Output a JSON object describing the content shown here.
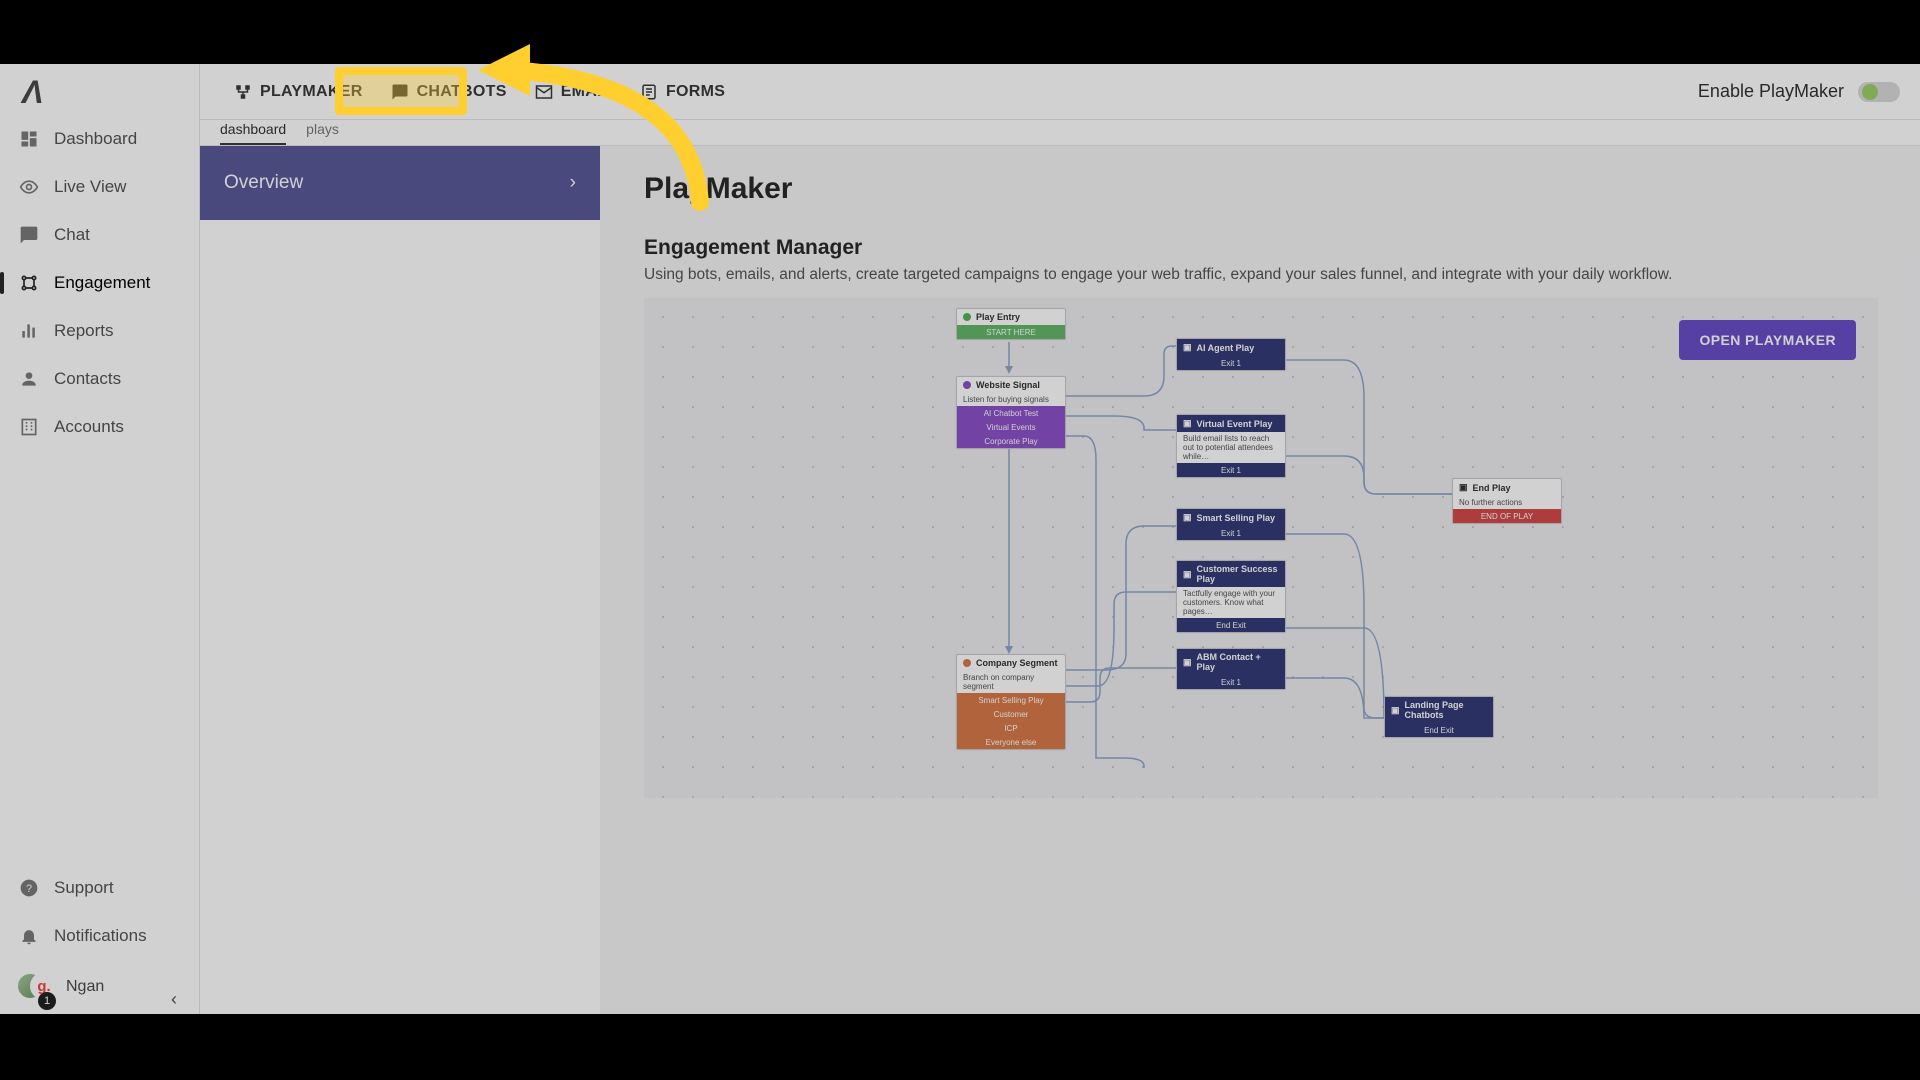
{
  "sidebar": {
    "items": [
      {
        "label": "Dashboard",
        "icon": "dashboard"
      },
      {
        "label": "Live View",
        "icon": "eye"
      },
      {
        "label": "Chat",
        "icon": "chat"
      },
      {
        "label": "Engagement",
        "icon": "engagement"
      },
      {
        "label": "Reports",
        "icon": "bar"
      },
      {
        "label": "Contacts",
        "icon": "person"
      },
      {
        "label": "Accounts",
        "icon": "building"
      }
    ],
    "bottom": [
      {
        "label": "Support",
        "icon": "help"
      },
      {
        "label": "Notifications",
        "icon": "bell"
      }
    ],
    "user": {
      "name": "Ngan",
      "badge": "1",
      "g": "g."
    }
  },
  "topTabs": [
    {
      "label": "PLAYMAKER",
      "icon": "flow"
    },
    {
      "label": "CHATBOTS",
      "icon": "chat"
    },
    {
      "label": "EMAIL",
      "icon": "mail"
    },
    {
      "label": "FORMS",
      "icon": "form"
    }
  ],
  "enable": {
    "label": "Enable PlayMaker"
  },
  "subTabs": [
    "dashboard",
    "plays"
  ],
  "overview": {
    "label": "Overview"
  },
  "page": {
    "title": "PlayMaker",
    "subtitle": "Engagement Manager",
    "desc": "Using bots, emails, and alerts, create targeted campaigns to engage your web traffic, expand your sales funnel, and integrate with your daily workflow.",
    "openBtn": "OPEN PLAYMAKER"
  },
  "flow": {
    "playEntry": {
      "title": "Play Entry",
      "bar": "START HERE"
    },
    "websiteSignal": {
      "title": "Website Signal",
      "sub": "Listen for buying signals",
      "bars": [
        "AI Chatbot Test",
        "Virtual Events",
        "Corporate Play"
      ]
    },
    "aiAgent": {
      "title": "AI Agent Play",
      "bar": "Exit 1"
    },
    "virtualEvent": {
      "title": "Virtual Event Play",
      "sub": "Build email lists to reach out to potential attendees while…",
      "bar": "Exit 1"
    },
    "smartSelling": {
      "title": "Smart Selling Play",
      "bar": "Exit 1"
    },
    "customerSuccess": {
      "title": "Customer Success Play",
      "sub": "Tactfully engage with your customers. Know what pages…",
      "bar": "End Exit"
    },
    "abm": {
      "title": "ABM Contact + Play",
      "bar": "Exit 1"
    },
    "companySegment": {
      "title": "Company Segment",
      "sub": "Branch on company segment",
      "bars": [
        "Smart Selling Play",
        "Customer",
        "ICP",
        "Everyone else"
      ]
    },
    "endPlay": {
      "title": "End Play",
      "sub": "No further actions",
      "bar": "END OF PLAY"
    },
    "landing": {
      "title": "Landing Page Chatbots",
      "bar": "End Exit"
    }
  }
}
